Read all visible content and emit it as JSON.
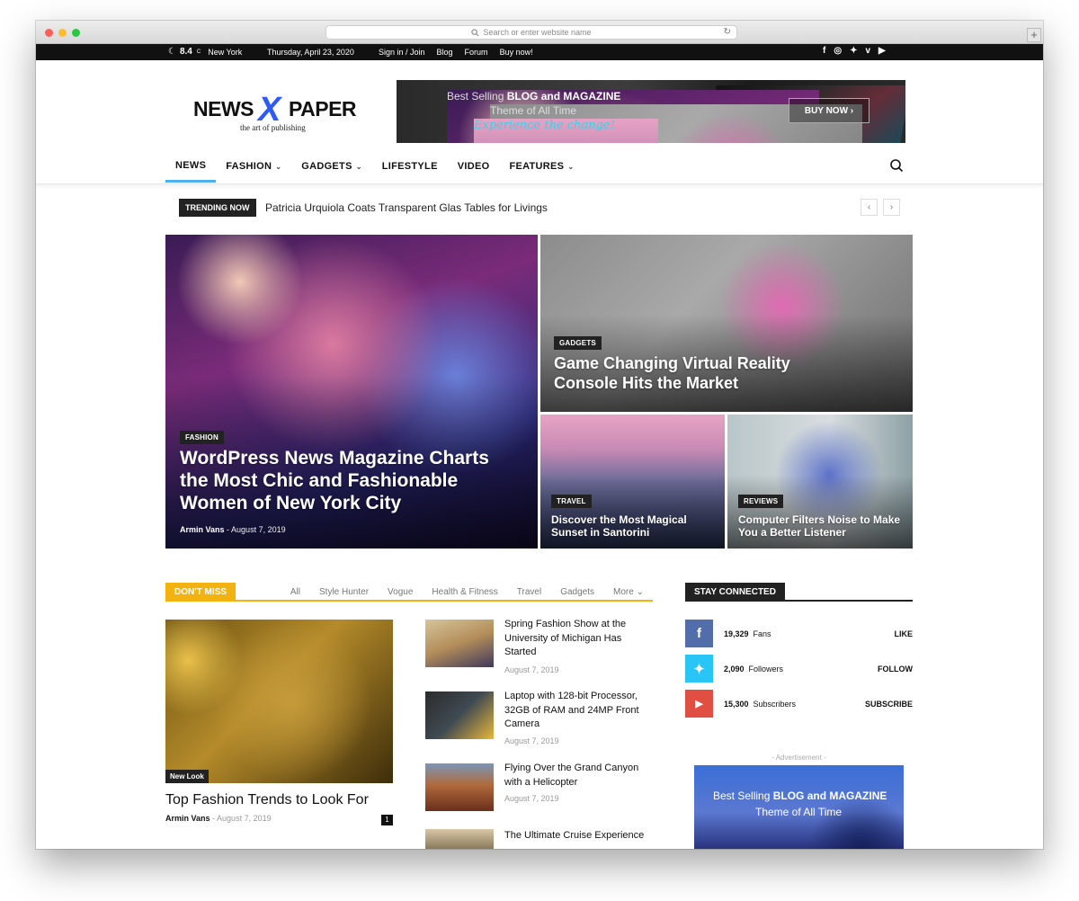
{
  "browser": {
    "url_placeholder": "Search or enter website name"
  },
  "topbar": {
    "temp": "8.4",
    "unit": "C",
    "city": "New York",
    "date": "Thursday, April 23, 2020",
    "links": [
      "Sign in / Join",
      "Blog",
      "Forum",
      "Buy now!"
    ],
    "social": [
      "facebook-icon",
      "instagram-icon",
      "twitter-icon",
      "vimeo-icon",
      "youtube-icon"
    ]
  },
  "logo": {
    "word1": "NEWS",
    "x": "X",
    "word2": "PAPER",
    "tagline": "the art of publishing"
  },
  "banner": {
    "line1_pre": "Best Selling ",
    "line1_bold": "BLOG and MAGAZINE",
    "line2": "Theme of All Time",
    "line3": "Experience the change!",
    "button": "BUY NOW ›"
  },
  "nav": {
    "items": [
      {
        "label": "NEWS",
        "dropdown": false
      },
      {
        "label": "FASHION",
        "dropdown": true
      },
      {
        "label": "GADGETS",
        "dropdown": true
      },
      {
        "label": "LIFESTYLE",
        "dropdown": false
      },
      {
        "label": "VIDEO",
        "dropdown": false
      },
      {
        "label": "FEATURES",
        "dropdown": true
      }
    ],
    "accent": "#4db2ec"
  },
  "trending": {
    "badge": "TRENDING NOW",
    "headline": "Patricia Urquiola Coats Transparent Glas Tables for Livings"
  },
  "hero": {
    "main": {
      "category": "FASHION",
      "title": "WordPress News Magazine Charts the Most Chic and Fashionable Women of New York City",
      "author": "Armin Vans",
      "sep": " - ",
      "date": "August 7, 2019"
    },
    "top_right": {
      "category": "GADGETS",
      "title": "Game Changing Virtual Reality Console Hits the Market"
    },
    "bottom_left": {
      "category": "TRAVEL",
      "title": "Discover the Most Magical Sunset in Santorini"
    },
    "bottom_right": {
      "category": "REVIEWS",
      "title": "Computer Filters Noise to Make You a Better Listener"
    }
  },
  "dont_miss": {
    "badge": "DON'T MISS",
    "accent": "#f2b20f",
    "tabs": [
      "All",
      "Style Hunter",
      "Vogue",
      "Health & Fitness",
      "Travel",
      "Gadgets",
      "More"
    ],
    "featured": {
      "category": "New Look",
      "title": "Top Fashion Trends to Look For",
      "author": "Armin Vans",
      "sep": " - ",
      "date": "August 7, 2019",
      "comments": "1"
    },
    "list": [
      {
        "title": "Spring Fashion Show at the University of Michigan Has Started",
        "date": "August 7, 2019"
      },
      {
        "title": "Laptop with 128-bit Processor, 32GB of RAM and 24MP Front Camera",
        "date": "August 7, 2019"
      },
      {
        "title": "Flying Over the Grand Canyon with a Helicopter",
        "date": "August 7, 2019"
      },
      {
        "title": "The Ultimate Cruise Experience",
        "date": ""
      }
    ]
  },
  "stay_connected": {
    "badge": "STAY CONNECTED",
    "rows": [
      {
        "icon": "facebook-icon",
        "glyph": "f",
        "color": "#516eab",
        "count": "19,329",
        "label": "Fans",
        "action": "LIKE"
      },
      {
        "icon": "twitter-icon",
        "glyph": "t",
        "color": "#29c5f6",
        "count": "2,090",
        "label": "Followers",
        "action": "FOLLOW"
      },
      {
        "icon": "youtube-icon",
        "glyph": "▶",
        "color": "#e14e42",
        "count": "15,300",
        "label": "Subscribers",
        "action": "SUBSCRIBE"
      }
    ]
  },
  "ad": {
    "label": "- Advertisement -",
    "line1_pre": "Best Selling ",
    "line1_bold": "BLOG and MAGAZINE",
    "line2": "Theme of All Time"
  }
}
